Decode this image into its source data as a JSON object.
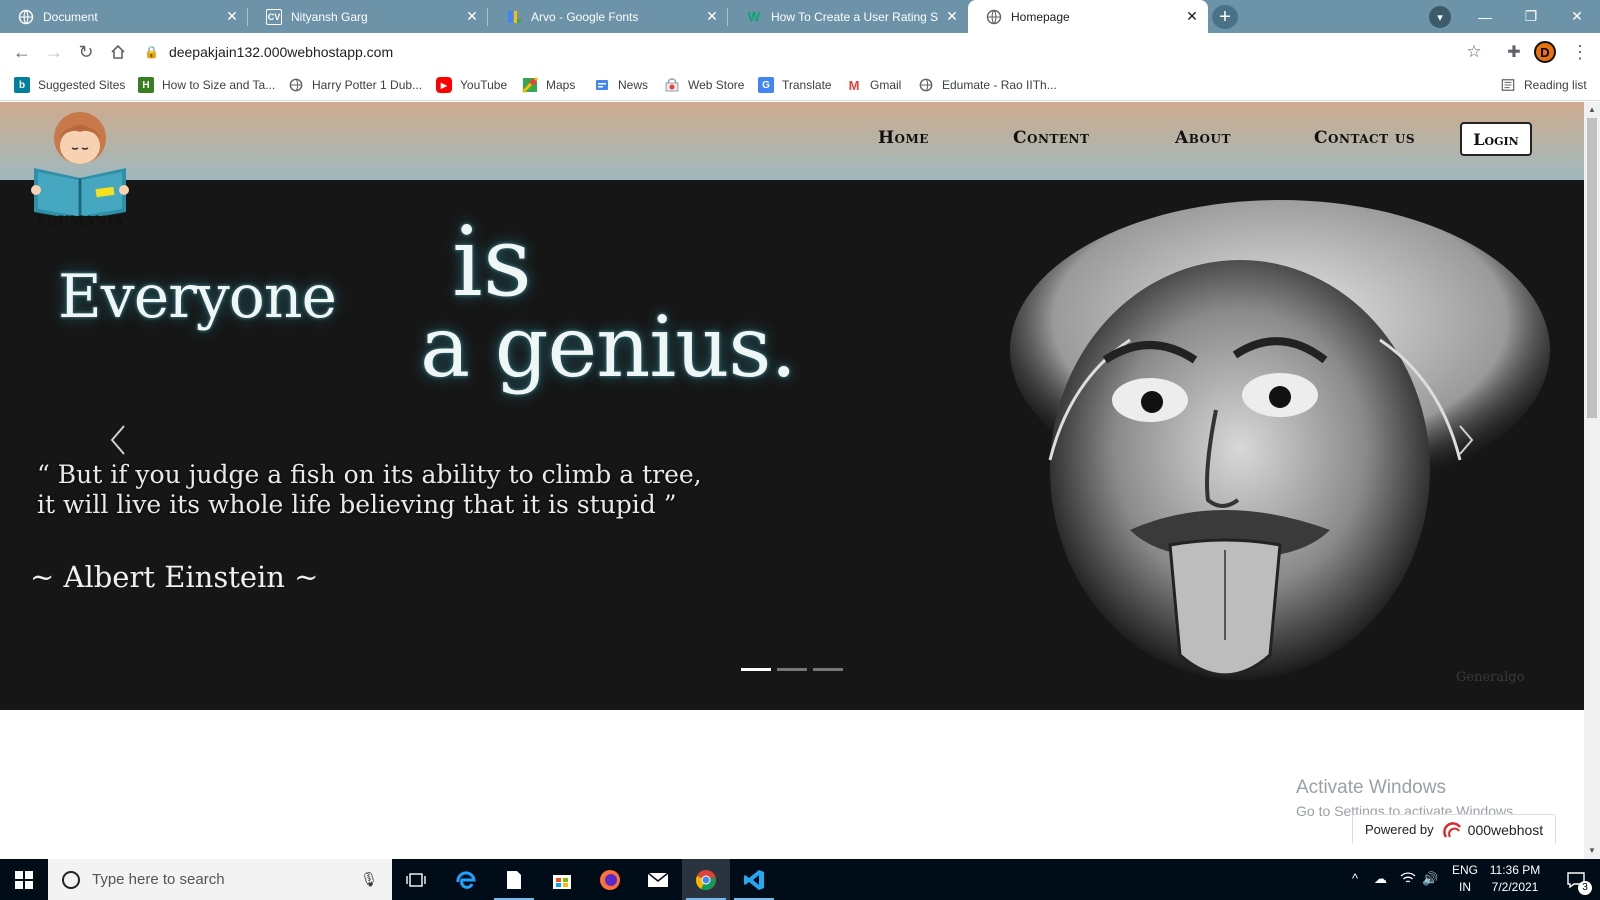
{
  "browser": {
    "tabs": [
      {
        "title": "Document",
        "favicon": "globe-icon",
        "active": false
      },
      {
        "title": "Nityansh Garg",
        "favicon": "cv-icon",
        "active": false
      },
      {
        "title": "Arvo - Google Fonts",
        "favicon": "google-fonts-icon",
        "active": false
      },
      {
        "title": "How To Create a User Rating Sco",
        "favicon": "w3schools-icon",
        "active": false
      },
      {
        "title": "Homepage",
        "favicon": "globe-icon",
        "active": true
      }
    ],
    "cv_favicon_text": "CV",
    "w3_favicon_text": "W",
    "url": "deepakjain132.000webhostapp.com",
    "profile_initial": "D",
    "reading_list": "Reading list",
    "bookmarks": [
      {
        "label": "Suggested Sites",
        "icon": "bing-icon"
      },
      {
        "label": "How to Size and Ta...",
        "icon": "bookmark-site-icon"
      },
      {
        "label": "Harry Potter 1 Dub...",
        "icon": "globe-icon"
      },
      {
        "label": "YouTube",
        "icon": "youtube-icon"
      },
      {
        "label": "Maps",
        "icon": "maps-icon"
      },
      {
        "label": "News",
        "icon": "news-icon"
      },
      {
        "label": "Web Store",
        "icon": "web-store-icon"
      },
      {
        "label": "Translate",
        "icon": "translate-icon"
      },
      {
        "label": "Gmail",
        "icon": "gmail-icon"
      },
      {
        "label": "Edumate - Rao IITh...",
        "icon": "globe-icon"
      }
    ]
  },
  "site": {
    "logo_text": "EDUMANIA",
    "nav": {
      "home": "Home",
      "content": "Content",
      "about": "About",
      "contact": "Contact us",
      "login": "Login"
    },
    "slide": {
      "line1": "Everyone",
      "line1_big": "is",
      "line2": "a genius.",
      "quote_line1": "“ But if you judge a fish on its ability to climb a tree,",
      "quote_line2": "it will live its whole life believing that it is stupid ”",
      "author": "~ Albert Einstein ~",
      "watermark": "Generalgo"
    },
    "carousel_indicators": 3,
    "carousel_active_index": 0
  },
  "overlay": {
    "activate_title": "Activate Windows",
    "activate_sub": "Go to Settings to activate Windows.",
    "powered_by": "Powered by",
    "powered_brand": "000webhost"
  },
  "taskbar": {
    "search_placeholder": "Type here to search",
    "lang_1": "ENG",
    "lang_2": "IN",
    "time": "11:36 PM",
    "date": "7/2/2021",
    "notification_count": "3"
  },
  "colors": {
    "tabstrip": "#6c93a8",
    "nav_gradient_top": "#cfa98f",
    "nav_gradient_bottom": "#9fb8bf",
    "carousel_bg": "#161616"
  }
}
